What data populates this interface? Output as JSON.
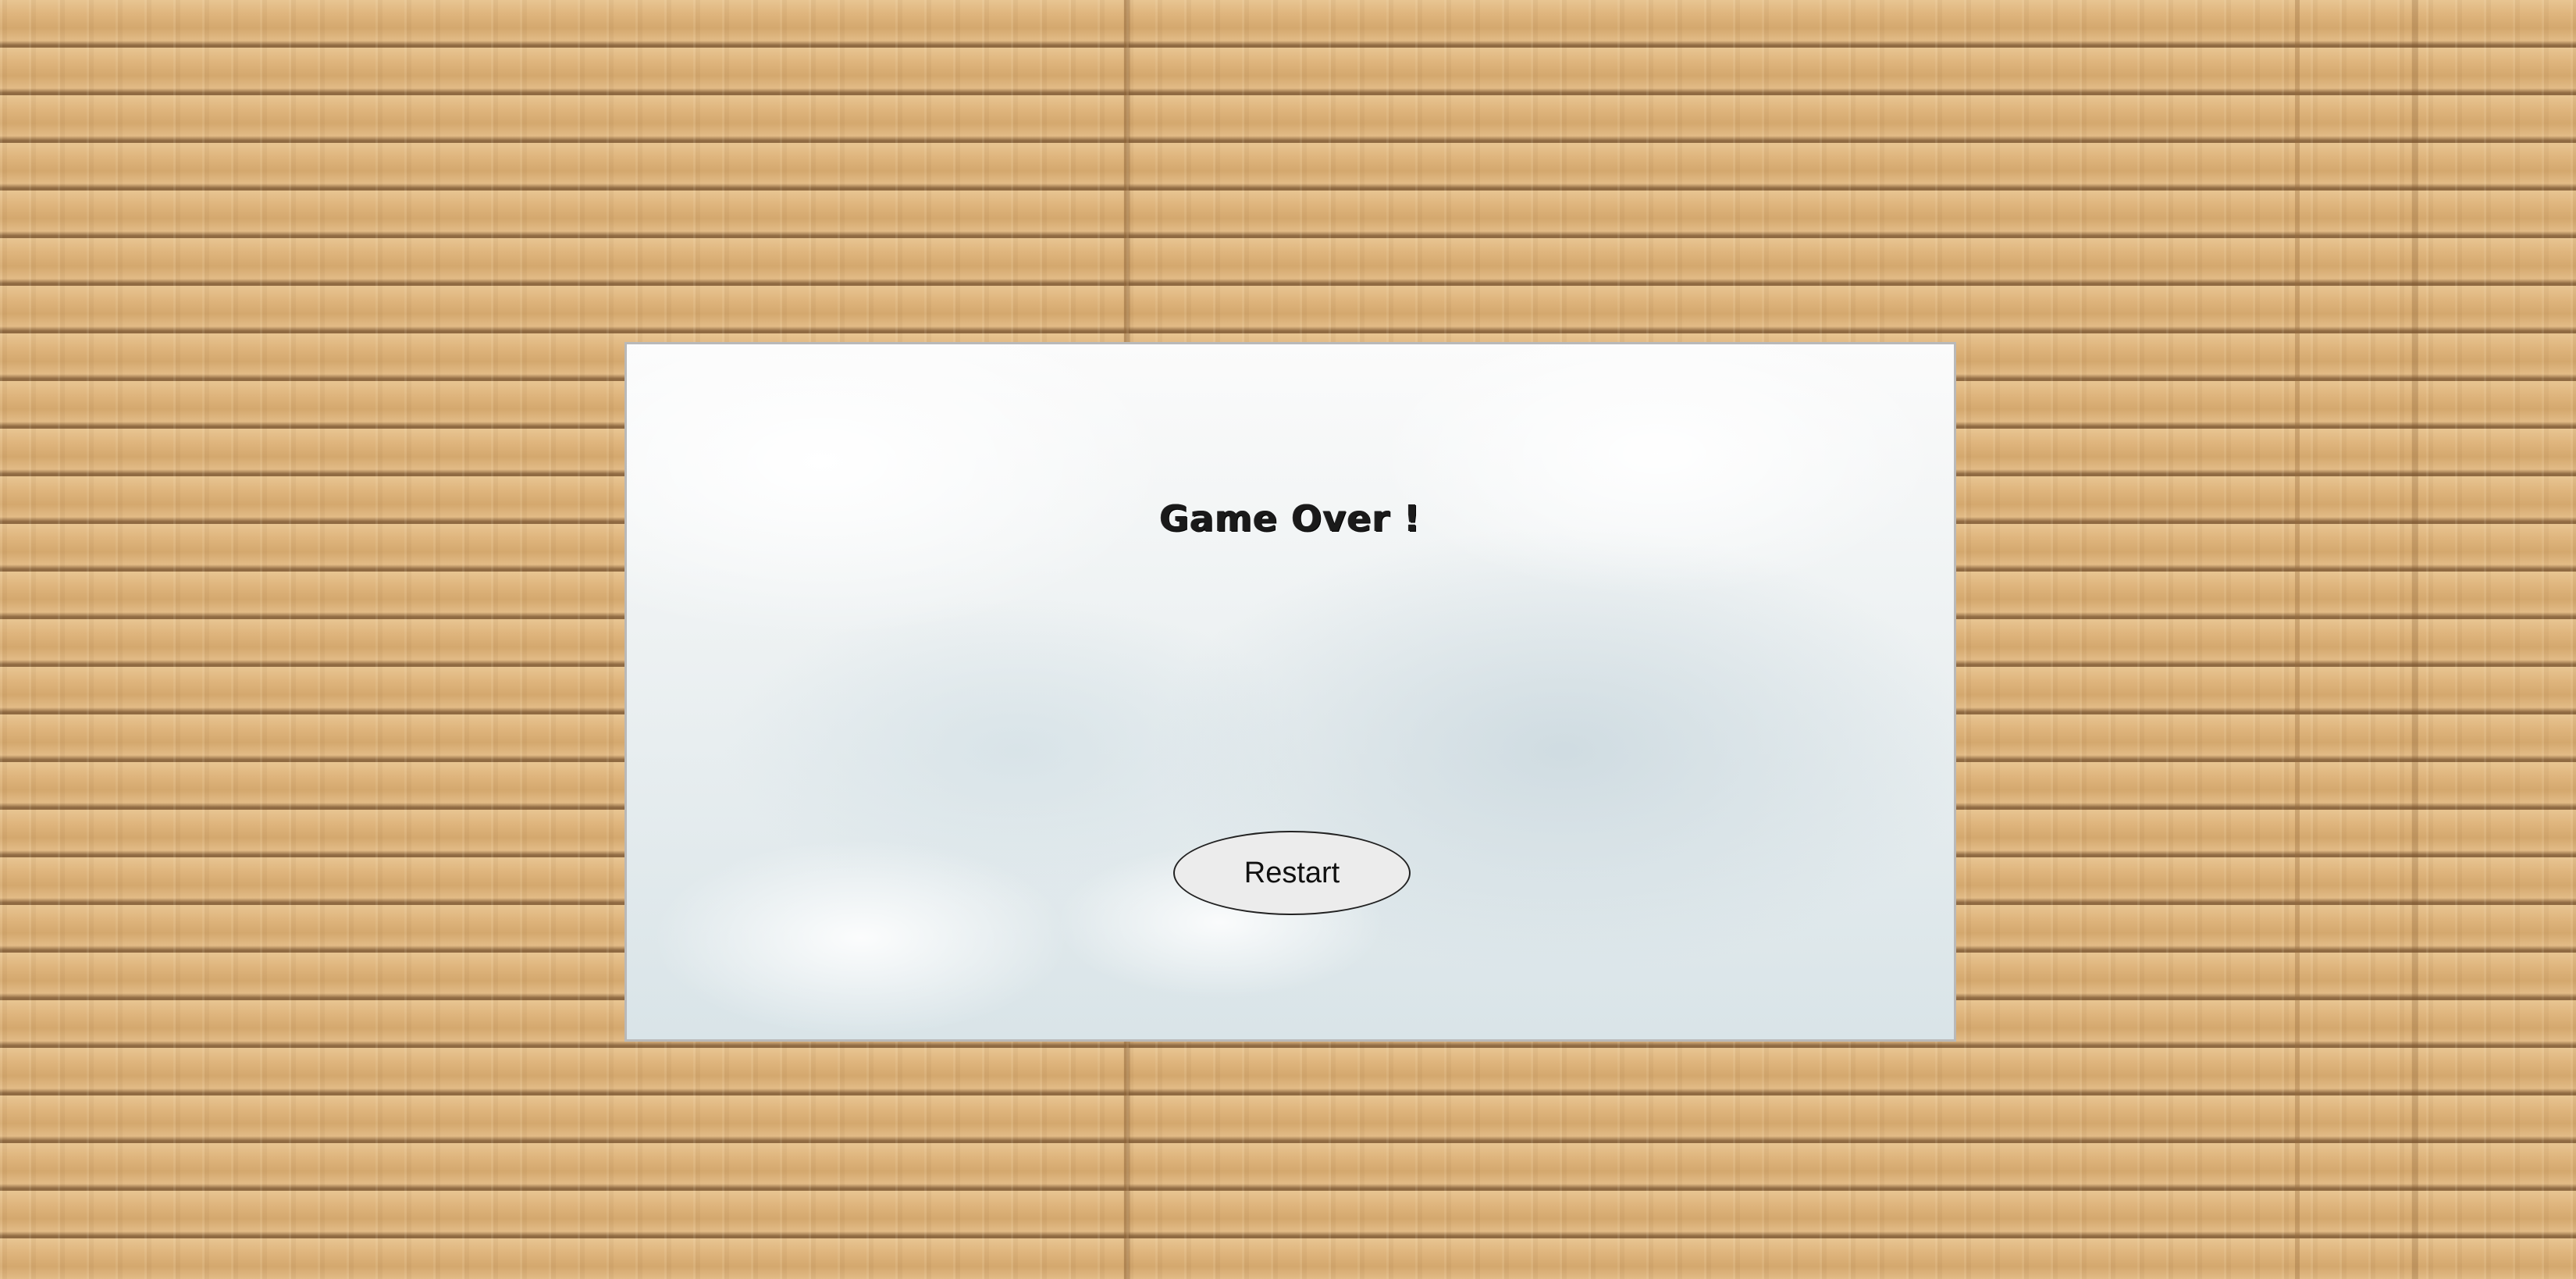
{
  "game": {
    "title": "Game Over !",
    "restart_label": "Restart"
  },
  "colors": {
    "wood": "#dcb27a",
    "panel_border": "#b9b9b9",
    "button_bg": "#ececec",
    "text": "#111111"
  }
}
